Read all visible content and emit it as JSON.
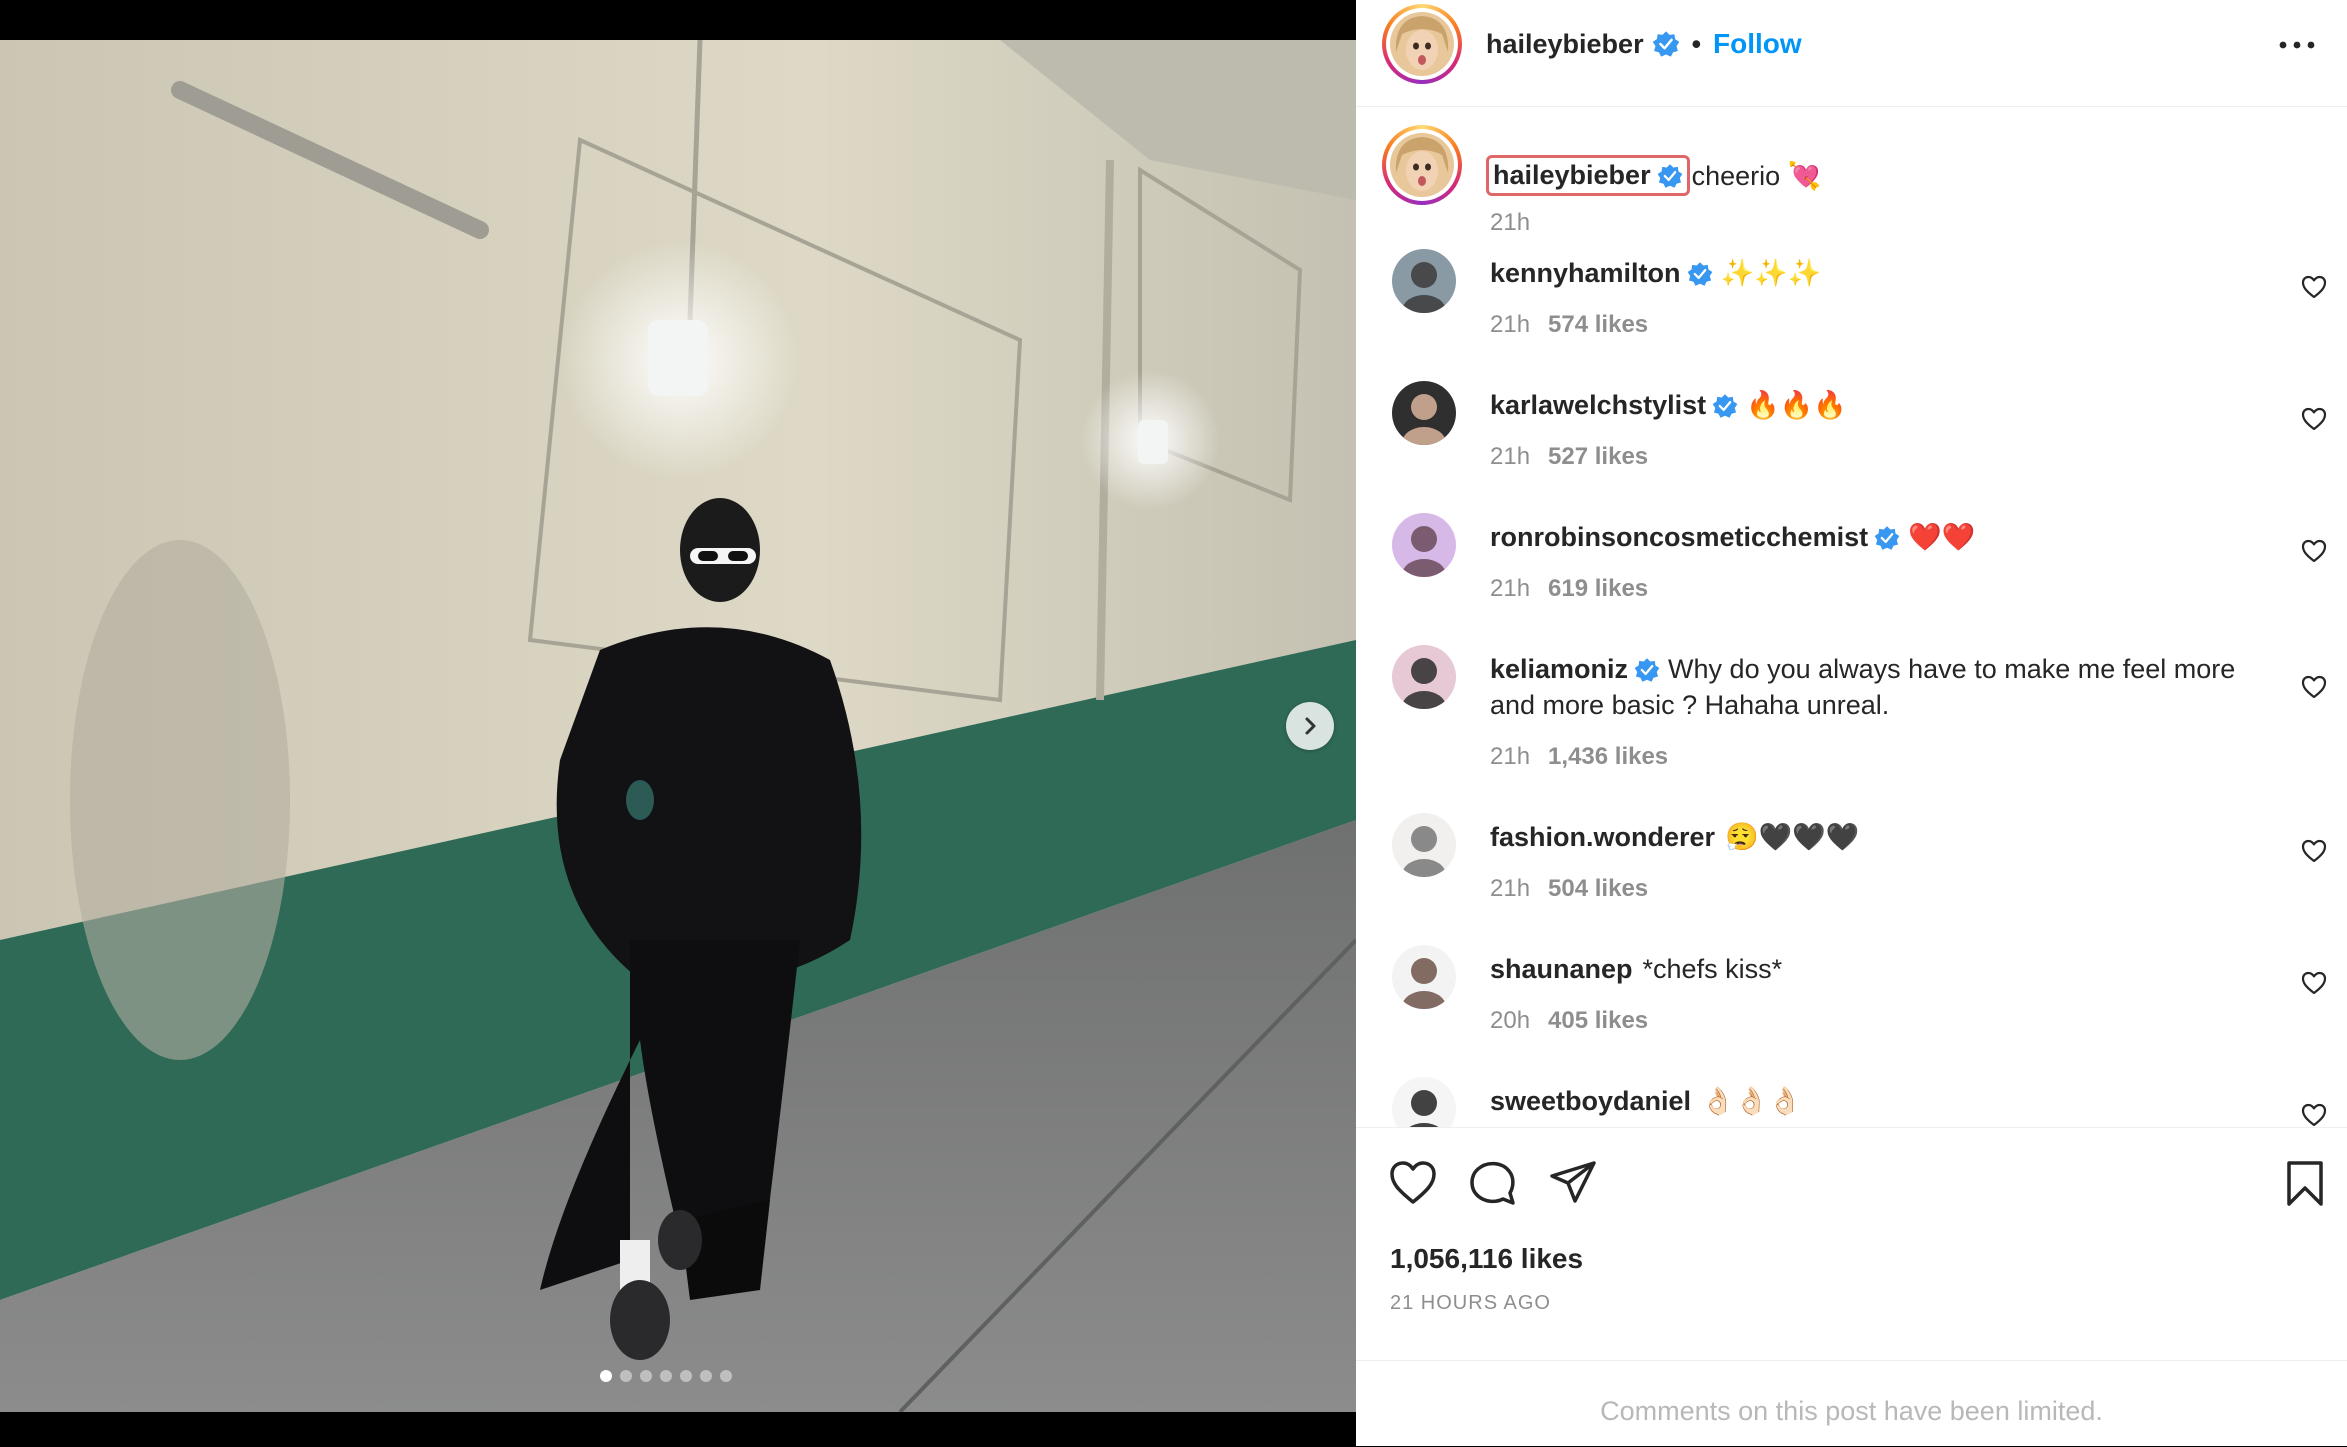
{
  "post": {
    "username": "haileybieber",
    "follow_label": "Follow",
    "separator": "•",
    "caption_text": "cheerio 💘",
    "caption_time": "21h",
    "carousel_count": 7,
    "carousel_active": 0
  },
  "comments": [
    {
      "user": "kennyhamilton",
      "verified": true,
      "text": "✨✨✨",
      "time": "21h",
      "likes": "574 likes"
    },
    {
      "user": "karlawelchstylist",
      "verified": true,
      "text": "🔥🔥🔥",
      "time": "21h",
      "likes": "527 likes"
    },
    {
      "user": "ronrobinsoncosmeticchemist",
      "verified": true,
      "text": "❤️❤️",
      "time": "21h",
      "likes": "619 likes"
    },
    {
      "user": "keliamoniz",
      "verified": true,
      "text": "Why do you always have to make me feel more and more basic ? Hahaha unreal.",
      "time": "21h",
      "likes": "1,436 likes"
    },
    {
      "user": "fashion.wonderer",
      "verified": false,
      "text": "😮‍💨🖤🖤🖤",
      "time": "21h",
      "likes": "504 likes"
    },
    {
      "user": "shaunanep",
      "verified": false,
      "text": "*chefs kiss*",
      "time": "20h",
      "likes": "405 likes"
    },
    {
      "user": "sweetboydaniel",
      "verified": false,
      "text": "👌🏻👌🏻👌🏻",
      "time": "",
      "likes": ""
    }
  ],
  "actions": {
    "likes_total": "1,056,116 likes",
    "posted_ago": "21 HOURS AGO",
    "limited_notice": "Comments on this post have been limited."
  },
  "colors": {
    "accent": "#0095f6",
    "verified": "#3897f0",
    "highlight_border": "#e06767",
    "muted": "#8e8e8e"
  },
  "icons": {
    "verified": "verified-badge-icon",
    "more": "more-options-icon",
    "like": "heart-icon",
    "comment": "comment-icon",
    "share": "share-icon",
    "save": "bookmark-icon",
    "next": "chevron-right-icon"
  }
}
